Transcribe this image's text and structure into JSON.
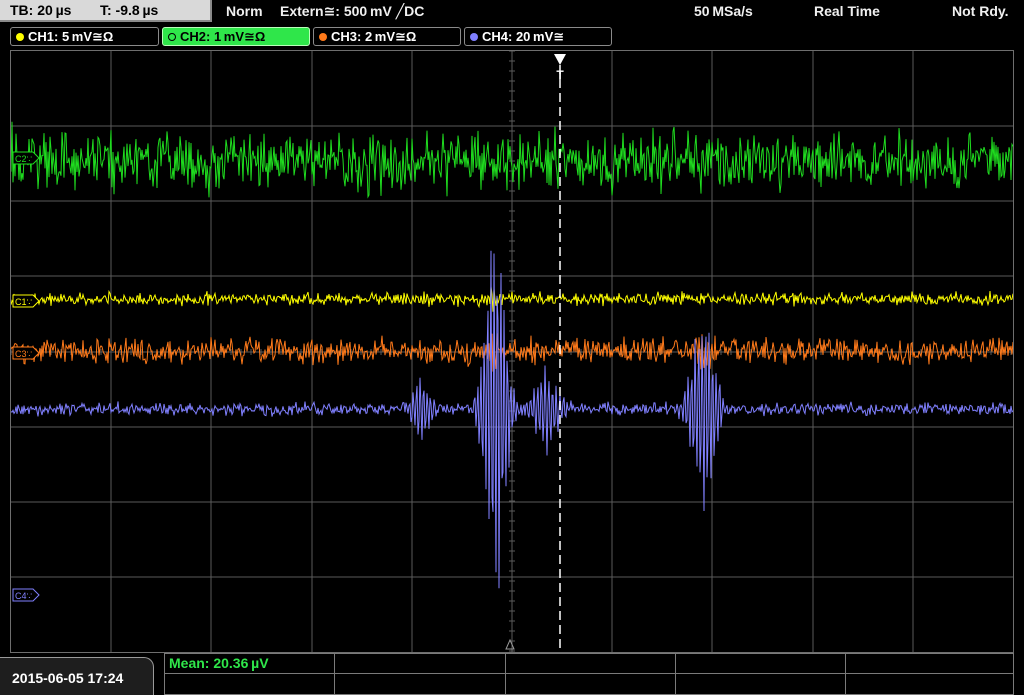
{
  "header": {
    "timebase": "TB: 20 µs",
    "trigger_time": "T: -9.8 µs",
    "trigger_mode": "Norm",
    "trigger_source": "Extern≅: 500 mV ╱DC",
    "sample_rate": "50 MSa/s",
    "acq_mode": "Real Time",
    "status": "Not Rdy."
  },
  "channels": [
    {
      "id": "ch1",
      "label": "CH1: 5 mV≅Ω",
      "color": "#ffff00",
      "marker": "C1∵",
      "active": false
    },
    {
      "id": "ch2",
      "label": "CH2: 1 mV≅Ω",
      "color": "#1fdc1f",
      "marker": "C2∵",
      "active": true
    },
    {
      "id": "ch3",
      "label": "CH3: 2 mV≅Ω",
      "color": "#ff7a1a",
      "marker": "C3∵",
      "active": false
    },
    {
      "id": "ch4",
      "label": "CH4: 20 mV≅",
      "color": "#8080ff",
      "marker": "C4∵",
      "active": false
    }
  ],
  "trigger_marker": "T",
  "footer": {
    "datetime": "2015-06-05 17:24",
    "measurement": "Mean: 20.36 µV"
  },
  "colors": {
    "grid": "#5a5a5a",
    "trigger_line": "#ffffff",
    "measurement_text": "#2fe64a",
    "header_box": "#d9d9d9"
  }
}
